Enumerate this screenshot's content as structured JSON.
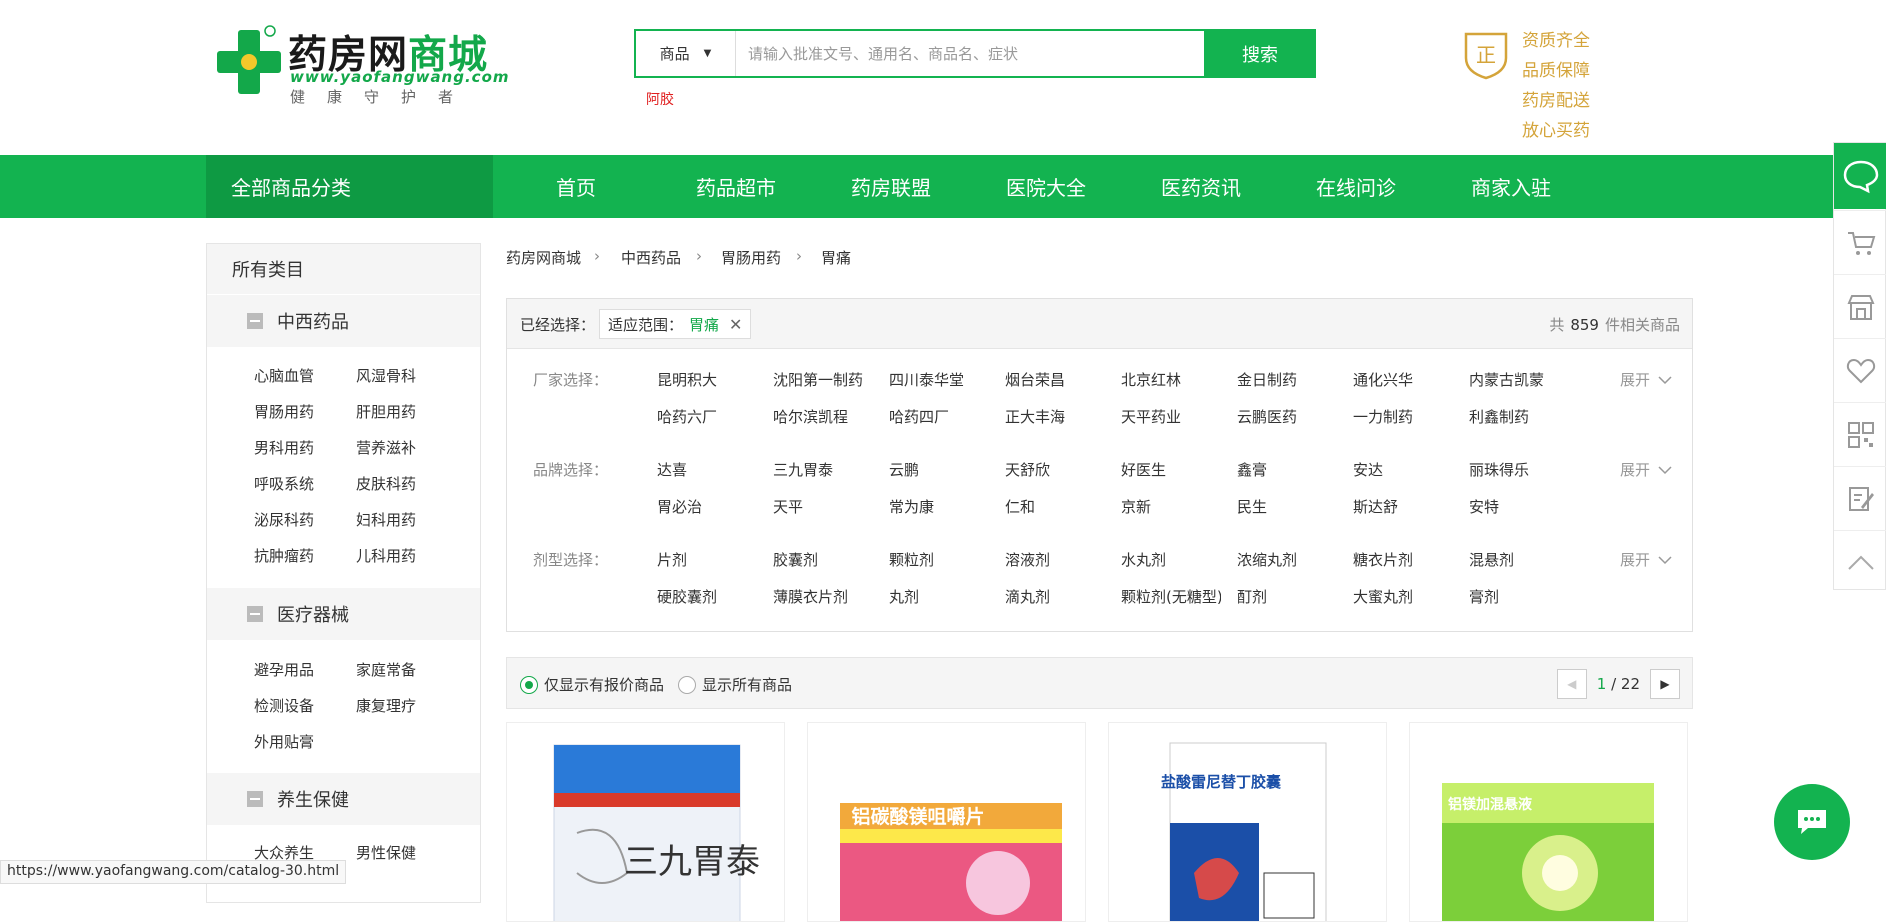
{
  "header": {
    "logo_title_a": "药房网",
    "logo_title_b": "商城",
    "logo_url": "www.yaofangwang.com",
    "logo_slogan": "健康守护者",
    "search_category": "商品",
    "search_placeholder": "请输入批准文号、通用名、商品名、症状",
    "search_button": "搜索",
    "hot_keyword": "阿胶",
    "badge_char": "正",
    "promises": [
      "资质齐全",
      "品质保障",
      "药房配送",
      "放心买药"
    ]
  },
  "nav": {
    "all_categories": "全部商品分类",
    "items": [
      "首页",
      "药品超市",
      "药房联盟",
      "医院大全",
      "医药资讯",
      "在线问诊",
      "商家入驻"
    ]
  },
  "sidebar": {
    "heading": "所有类目",
    "groups": [
      {
        "title": "中西药品",
        "items": [
          "心脑血管",
          "风湿骨科",
          "胃肠用药",
          "肝胆用药",
          "男科用药",
          "营养滋补",
          "呼吸系统",
          "皮肤科药",
          "泌尿科药",
          "妇科用药",
          "抗肿瘤药",
          "儿科用药"
        ]
      },
      {
        "title": "医疗器械",
        "items": [
          "避孕用品",
          "家庭常备",
          "检测设备",
          "康复理疗",
          "外用贴膏"
        ]
      },
      {
        "title": "养生保健",
        "items": [
          "大众养生",
          "男性保健"
        ]
      }
    ]
  },
  "breadcrumb": [
    "药房网商城",
    "中西药品",
    "胃肠用药",
    "胃痛"
  ],
  "filter": {
    "chosen_label": "已经选择：",
    "chip_key": "适应范围：",
    "chip_value": "胃痛",
    "chip_close": "✕",
    "total_prefix": "共",
    "total_count": "859",
    "total_suffix": "件相关商品",
    "expand": "展开",
    "rows": [
      {
        "label": "厂家选择：",
        "options": [
          "昆明积大",
          "沈阳第一制药",
          "四川泰华堂",
          "烟台荣昌",
          "北京红林",
          "金日制药",
          "通化兴华",
          "内蒙古凯蒙",
          "哈药六厂",
          "哈尔滨凯程",
          "哈药四厂",
          "正大丰海",
          "天平药业",
          "云鹏医药",
          "一力制药",
          "利鑫制药"
        ]
      },
      {
        "label": "品牌选择：",
        "options": [
          "达喜",
          "三九胃泰",
          "云鹏",
          "天舒欣",
          "好医生",
          "鑫膏",
          "安达",
          "丽珠得乐",
          "胃必治",
          "天平",
          "常为康",
          "仁和",
          "京新",
          "民生",
          "斯达舒",
          "安特"
        ]
      },
      {
        "label": "剂型选择：",
        "options": [
          "片剂",
          "胶囊剂",
          "颗粒剂",
          "溶液剂",
          "水丸剂",
          "浓缩丸剂",
          "糖衣片剂",
          "混悬剂",
          "硬胶囊剂",
          "薄膜衣片剂",
          "丸剂",
          "滴丸剂",
          "颗粒剂(无糖型)",
          "酊剂",
          "大蜜丸剂",
          "膏剂"
        ]
      }
    ]
  },
  "toolbar": {
    "opt_priced": "仅显示有报价商品",
    "opt_all": "显示所有商品",
    "page_current": "1",
    "page_sep": "/",
    "page_total": "22"
  },
  "products": [
    {
      "box_text": "三九胃泰",
      "colors": [
        "#e8eef8",
        "#2a7ad8"
      ]
    },
    {
      "box_text": "铝碳酸镁咀嚼片",
      "colors": [
        "#fde84a",
        "#e83e8c"
      ]
    },
    {
      "box_text": "盐酸雷尼替丁胶囊",
      "colors": [
        "#ffffff",
        "#1b4fa8"
      ]
    },
    {
      "box_text": "铝镁加混悬液",
      "colors": [
        "#7ccf3a",
        "#c6ef6a"
      ]
    }
  ],
  "status_url": "https://www.yaofangwang.com/catalog-30.html",
  "colors": {
    "brand_green": "#13b350",
    "gold": "#d4a43a",
    "hot_red": "#e02020"
  }
}
